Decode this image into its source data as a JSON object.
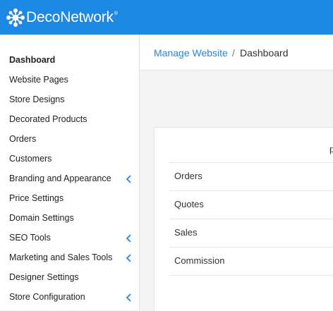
{
  "brand": {
    "name": "DecoNetwork",
    "registered": "®"
  },
  "sidebar": {
    "items": [
      {
        "label": "Dashboard",
        "active": true,
        "has_submenu": false
      },
      {
        "label": "Website Pages",
        "has_submenu": false
      },
      {
        "label": "Store Designs",
        "has_submenu": false
      },
      {
        "label": "Decorated Products",
        "has_submenu": false
      },
      {
        "label": "Orders",
        "has_submenu": false
      },
      {
        "label": "Customers",
        "has_submenu": false
      },
      {
        "label": "Branding and Appearance",
        "has_submenu": true
      },
      {
        "label": "Price Settings",
        "has_submenu": false
      },
      {
        "label": "Domain Settings",
        "has_submenu": false
      },
      {
        "label": "SEO Tools",
        "has_submenu": true
      },
      {
        "label": "Marketing and Sales Tools",
        "has_submenu": true
      },
      {
        "label": "Designer Settings",
        "has_submenu": false
      },
      {
        "label": "Store Configuration",
        "has_submenu": true
      }
    ]
  },
  "breadcrumb": {
    "parent": "Manage Website",
    "separator": "/",
    "current": "Dashboard"
  },
  "summary": {
    "header_fragment": "p",
    "rows": [
      "Orders",
      "Quotes",
      "Sales",
      "Commission"
    ]
  },
  "colors": {
    "brand_blue": "#1e88e5",
    "chevron": "#1e88e5"
  },
  "icons": {
    "submenu": "chevron-left-icon",
    "logo": "deconetwork-logo-icon"
  }
}
